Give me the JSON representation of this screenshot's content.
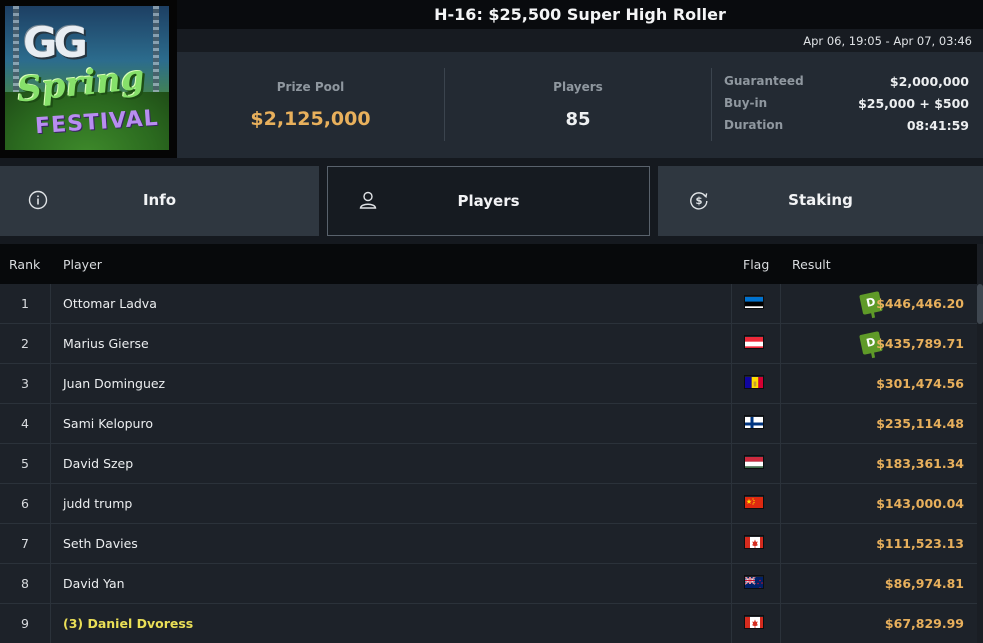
{
  "logo": {
    "line1": "GG",
    "line2": "Spring",
    "line3": "FESTIVAL"
  },
  "header": {
    "title": "H-16: $25,500 Super High Roller",
    "date_range": "Apr 06, 19:05 - Apr 07, 03:46"
  },
  "stats": {
    "prize_pool_label": "Prize Pool",
    "prize_pool_value": "$2,125,000",
    "players_label": "Players",
    "players_value": "85",
    "details": [
      {
        "label": "Guaranteed",
        "value": "$2,000,000"
      },
      {
        "label": "Buy-in",
        "value": "$25,000 + $500"
      },
      {
        "label": "Duration",
        "value": "08:41:59"
      }
    ]
  },
  "tabs": [
    {
      "label": "Info",
      "icon": "info-icon",
      "active": false
    },
    {
      "label": "Players",
      "icon": "user-icon",
      "active": true
    },
    {
      "label": "Staking",
      "icon": "dollar-icon",
      "active": false
    }
  ],
  "table": {
    "columns": {
      "rank": "Rank",
      "player": "Player",
      "flag": "Flag",
      "result": "Result"
    },
    "rows": [
      {
        "rank": "1",
        "player": "Ottomar Ladva",
        "flag": "estonia",
        "result": "$446,446.20",
        "badge": "D"
      },
      {
        "rank": "2",
        "player": "Marius Gierse",
        "flag": "austria",
        "result": "$435,789.71",
        "badge": "D"
      },
      {
        "rank": "3",
        "player": "Juan Dominguez",
        "flag": "andorra",
        "result": "$301,474.56"
      },
      {
        "rank": "4",
        "player": "Sami Kelopuro",
        "flag": "finland",
        "result": "$235,114.48"
      },
      {
        "rank": "5",
        "player": "David Szep",
        "flag": "hungary",
        "result": "$183,361.34"
      },
      {
        "rank": "6",
        "player": "judd trump",
        "flag": "china",
        "result": "$143,000.04"
      },
      {
        "rank": "7",
        "player": "Seth Davies",
        "flag": "canada",
        "result": "$111,523.13"
      },
      {
        "rank": "8",
        "player": "David Yan",
        "flag": "new-zealand",
        "result": "$86,974.81"
      },
      {
        "rank": "9",
        "player": "(3) Daniel Dvoress",
        "flag": "canada",
        "result": "$67,829.99",
        "highlight": true
      }
    ]
  },
  "colors": {
    "accent_gold": "#e8b05c",
    "highlight_yellow": "#eadf57",
    "badge_green": "#5f9a28"
  }
}
